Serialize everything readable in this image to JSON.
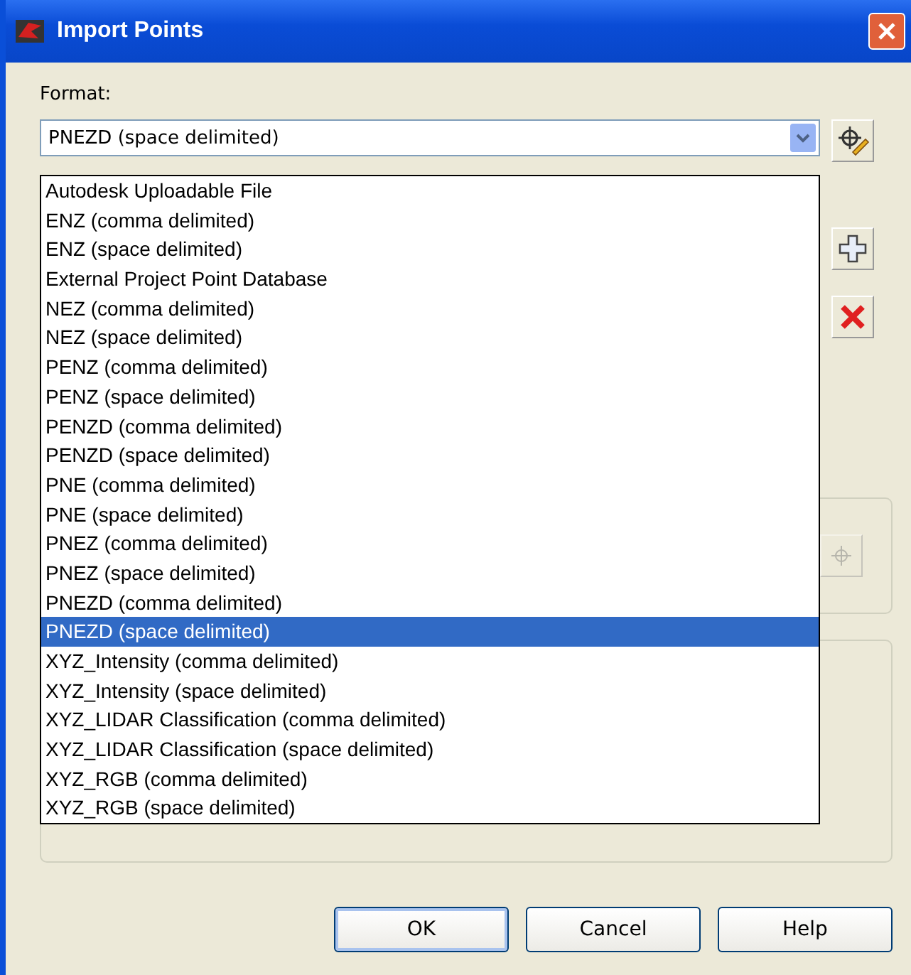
{
  "window": {
    "title": "Import Points"
  },
  "format": {
    "label": "Format:",
    "value": "PNEZD (space delimited)",
    "expanded": true,
    "options": [
      {
        "label": "Autodesk Uploadable File",
        "selected": false
      },
      {
        "label": "ENZ (comma delimited)",
        "selected": false
      },
      {
        "label": "ENZ (space delimited)",
        "selected": false
      },
      {
        "label": "External Project Point Database",
        "selected": false
      },
      {
        "label": "NEZ (comma delimited)",
        "selected": false
      },
      {
        "label": "NEZ (space delimited)",
        "selected": false
      },
      {
        "label": "PENZ (comma delimited)",
        "selected": false
      },
      {
        "label": "PENZ (space delimited)",
        "selected": false
      },
      {
        "label": "PENZD (comma delimited)",
        "selected": false
      },
      {
        "label": "PENZD (space delimited)",
        "selected": false
      },
      {
        "label": "PNE (comma delimited)",
        "selected": false
      },
      {
        "label": "PNE (space delimited)",
        "selected": false
      },
      {
        "label": "PNEZ (comma delimited)",
        "selected": false
      },
      {
        "label": "PNEZ (space delimited)",
        "selected": false
      },
      {
        "label": "PNEZD (comma delimited)",
        "selected": false
      },
      {
        "label": "PNEZD (space delimited)",
        "selected": true
      },
      {
        "label": "XYZ_Intensity (comma delimited)",
        "selected": false
      },
      {
        "label": "XYZ_Intensity (space delimited)",
        "selected": false
      },
      {
        "label": "XYZ_LIDAR Classification (comma delimited)",
        "selected": false
      },
      {
        "label": "XYZ_LIDAR Classification (space delimited)",
        "selected": false
      },
      {
        "label": "XYZ_RGB (comma delimited)",
        "selected": false
      },
      {
        "label": "XYZ_RGB (space delimited)",
        "selected": false
      }
    ]
  },
  "buttons": [
    "OK",
    "Cancel",
    "Help"
  ]
}
